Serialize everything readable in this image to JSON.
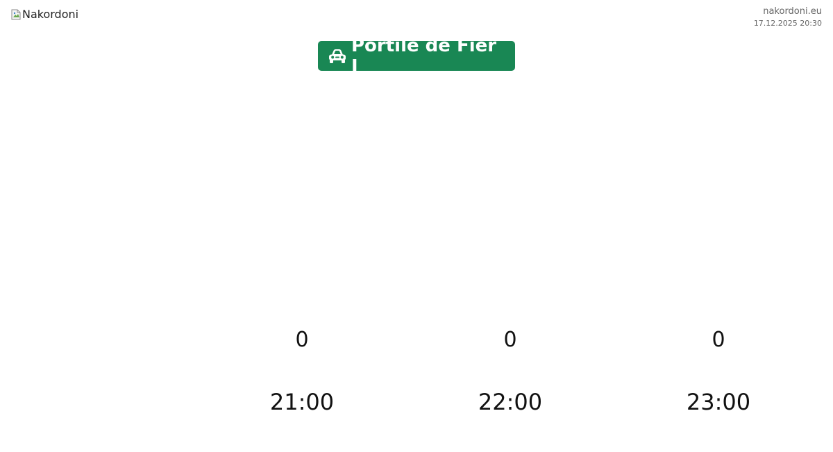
{
  "header": {
    "logo_alt": "Nakordoni",
    "domain": "nakordoni.eu",
    "datetime": "17.12.2025 20:30"
  },
  "title": {
    "label": "Portile de Fier I",
    "icon": "car-icon",
    "badge_color": "#198754"
  },
  "chart_data": {
    "type": "bar",
    "categories": [
      "21:00",
      "22:00",
      "23:00"
    ],
    "values": [
      0,
      0,
      0
    ],
    "title": "Portile de Fier I",
    "xlabel": "",
    "ylabel": "",
    "grid": false,
    "legend": "none"
  }
}
